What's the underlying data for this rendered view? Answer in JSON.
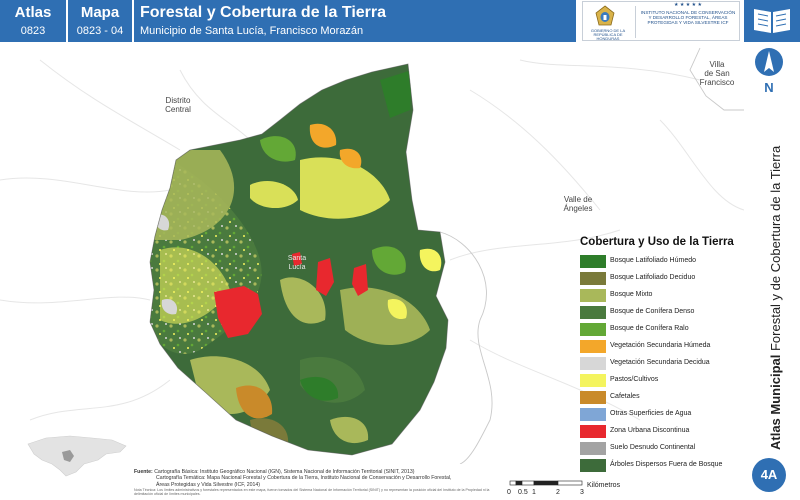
{
  "header": {
    "atlas_label": "Atlas",
    "atlas_code": "0823",
    "map_label": "Mapa",
    "map_code": "0823 - 04",
    "title": "Forestal y Cobertura de la Tierra",
    "subtitle": "Municipio de Santa Lucía, Francisco Morazán",
    "logo_gov": "GOBIERNO DE LA REPÚBLICA DE HONDURAS",
    "logo_icf": "INSTITUTO NACIONAL DE CONSERVACIÓN Y DESARROLLO FORESTAL, ÁREAS PROTEGIDAS Y VIDA SILVESTRE ICF",
    "logo_stars": "★ ★ ★ ★ ★"
  },
  "north_label": "N",
  "vertical_title": {
    "bold": "Atlas Municipal",
    "rest": " Forestal y de Cobertura de la Tierra"
  },
  "badge": "4A",
  "places": {
    "distrito_central": "Distrito\nCentral",
    "villa_san_francisco": "Villa\nde San\nFrancisco",
    "valle_angeles": "Valle de\nÁngeles",
    "santa_lucia": "Santa\nLucía"
  },
  "legend": {
    "title": "Cobertura y Uso de la Tierra",
    "items": [
      {
        "label": "Bosque Latifoliado Húmedo",
        "color": "#2e7d2a"
      },
      {
        "label": "Bosque Latifoliado Deciduo",
        "color": "#7a7a3a"
      },
      {
        "label": "Bosque Mixto",
        "color": "#a9b85a"
      },
      {
        "label": "Bosque de Conífera Denso",
        "color": "#4a7a3e"
      },
      {
        "label": "Bosque de Conífera Ralo",
        "color": "#63a836"
      },
      {
        "label": "Vegetación Secundaria Húmeda",
        "color": "#f3a72a"
      },
      {
        "label": "Vegetación Secundaria Decidua",
        "color": "#d7d7d7"
      },
      {
        "label": "Pastos/Cultivos",
        "color": "#f4f45e"
      },
      {
        "label": "Cafetales",
        "color": "#c98a2a"
      },
      {
        "label": "Otras Superficies de Agua",
        "color": "#7fa6d6"
      },
      {
        "label": "Zona Urbana Discontinua",
        "color": "#e8282e"
      },
      {
        "label": "Suelo Desnudo Continental",
        "color": "#a3a3a3"
      },
      {
        "label": "Árboles Dispersos Fuera de Bosque",
        "color": "#3d6b3a"
      }
    ]
  },
  "source": {
    "label": "Fuente:",
    "line1": "Cartografía Básica: Instituto Geográfico Nacional (IGN), Sistema Nacional de Información Territorial (SINIT, 2013)",
    "line2": "Cartografía Temática: Mapa Nacional Forestal y Cobertura de la Tierra, Instituto Nacional de Conservación y Desarrollo Forestal,",
    "line3": "Áreas Protegidas y Vida Silvestre (ICF, 2014)",
    "note": "Nota Técnica: Los límites administrativos y forestales representados en este mapa, fueron tomados del Sistema Nacional de Información Territorial (SINIT) y no representan la posición oficial del Instituto de la Propiedad ni la delimitación oficial de límites municipales."
  },
  "scale": {
    "unit": "Kilómetros",
    "ticks": [
      "0",
      "0.5",
      "1",
      "2",
      "3"
    ]
  }
}
